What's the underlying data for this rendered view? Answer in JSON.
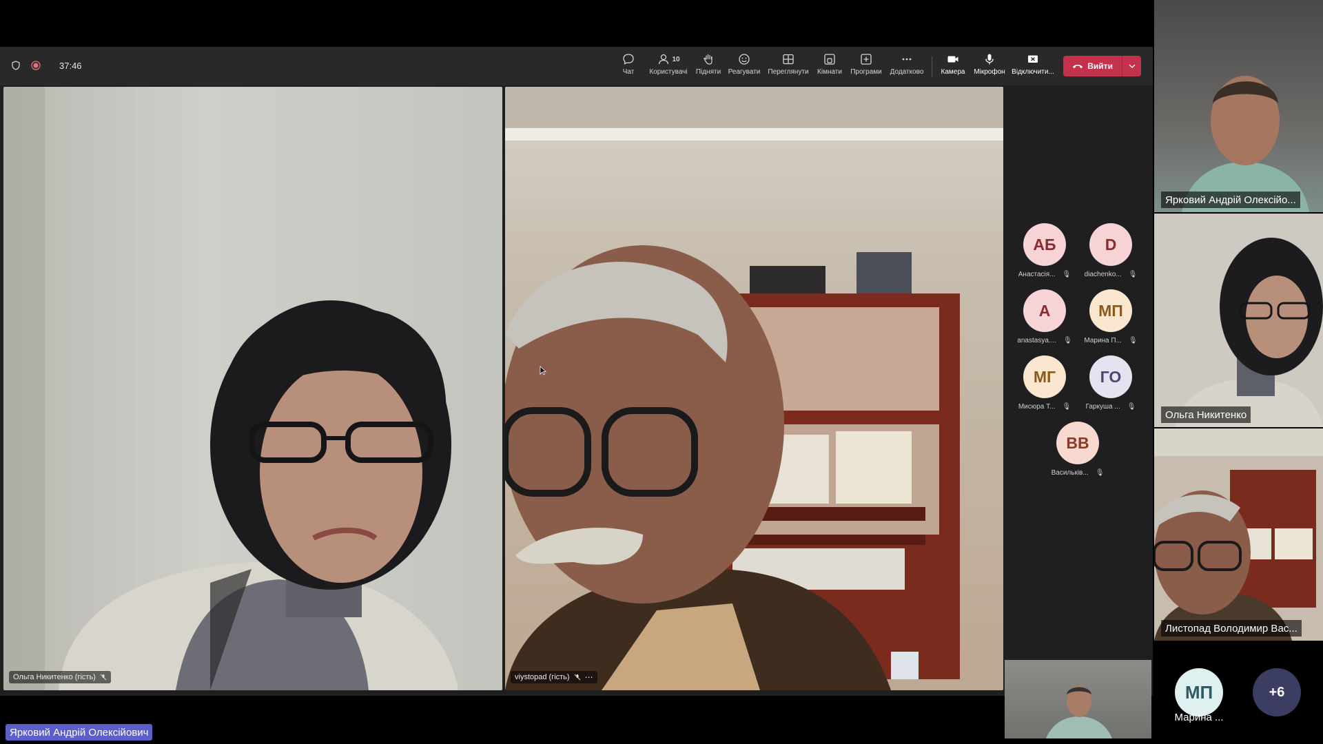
{
  "meeting": {
    "timer": "37:46",
    "toolbar": [
      {
        "key": "chat",
        "label": "Чат",
        "icon": "chat-icon"
      },
      {
        "key": "people",
        "label": "Користувачі",
        "icon": "people-icon",
        "count": "10"
      },
      {
        "key": "raise",
        "label": "Підняти",
        "icon": "raise-hand-icon"
      },
      {
        "key": "react",
        "label": "Реагувати",
        "icon": "react-icon"
      },
      {
        "key": "view",
        "label": "Переглянути",
        "icon": "view-icon"
      },
      {
        "key": "rooms",
        "label": "Кімнати",
        "icon": "rooms-icon"
      },
      {
        "key": "apps",
        "label": "Програми",
        "icon": "apps-icon"
      },
      {
        "key": "more",
        "label": "Додатково",
        "icon": "more-icon"
      },
      {
        "key": "camera",
        "label": "Камера",
        "icon": "camera-icon"
      },
      {
        "key": "mic",
        "label": "Мікрофон",
        "icon": "microphone-icon"
      },
      {
        "key": "share",
        "label": "Відключити...",
        "icon": "stop-share-icon"
      }
    ],
    "leave_label": "Вийти",
    "tiles": {
      "left_label": "Ольга Никитенко (гість)",
      "center_label": "viystopad (гість)"
    },
    "participants": [
      {
        "initials": "АБ",
        "name": "Анастасія...",
        "bg": "#f6d3d4",
        "fg": "#8a2b2f"
      },
      {
        "initials": "D",
        "name": "diachenko...",
        "bg": "#f6d3d4",
        "fg": "#8a2b2f"
      },
      {
        "initials": "A",
        "name": "anastasya....",
        "bg": "#f6d3d4",
        "fg": "#8a2b2f"
      },
      {
        "initials": "МП",
        "name": "Марина П...",
        "bg": "#fbe7cf",
        "fg": "#8a5a1c"
      },
      {
        "initials": "МГ",
        "name": "Мисюра Т...",
        "bg": "#fbe7cf",
        "fg": "#8a5a1c"
      },
      {
        "initials": "ГО",
        "name": "Гаркуша ...",
        "bg": "#e6e3f1",
        "fg": "#4a4773"
      },
      {
        "initials": "ВВ",
        "name": "Васильків...",
        "bg": "#f8d9cf",
        "fg": "#8a3a24"
      }
    ]
  },
  "gallery": {
    "tile1": "Ярковий Андрій Олексійо...",
    "tile2": "Ольга Никитенко",
    "tile3": "Листопад Володимир Вас...",
    "more_avatar_initials": "МП",
    "more_avatar_name": "Марина ...",
    "more_count": "+6"
  },
  "host_name": "Ярковий Андрій Олексійович",
  "colors": {
    "leave": "#c4314b",
    "host_badge": "#5b5fc7",
    "toolbar": "#292929",
    "more_bubble": "#3b3d63"
  }
}
